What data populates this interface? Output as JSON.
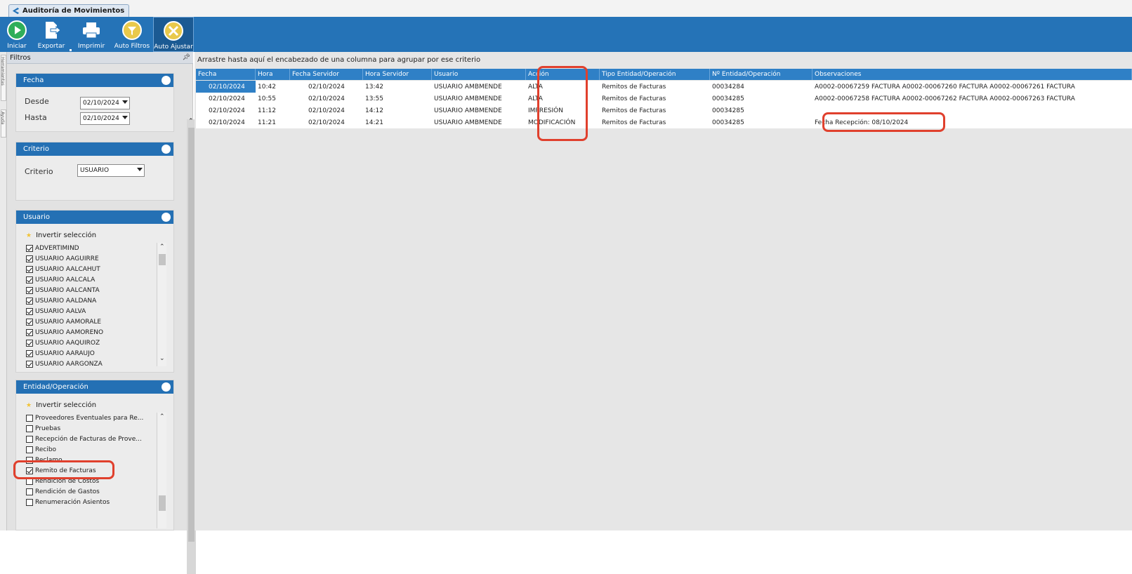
{
  "window": {
    "tab_title": "Auditoría de Movimientos"
  },
  "ribbon": {
    "buttons": [
      {
        "label": "Iniciar",
        "icon": "play-icon"
      },
      {
        "label": "Exportar",
        "icon": "export-icon"
      },
      {
        "label": "Imprimir",
        "icon": "printer-icon"
      },
      {
        "label": "Auto Filtros",
        "icon": "auto-filter-icon"
      },
      {
        "label": "Auto Ajustar",
        "icon": "auto-fit-icon"
      }
    ]
  },
  "side_tabs": [
    "Herramientas",
    "Ayuda"
  ],
  "filters": {
    "panel_title": "Filtros",
    "fecha": {
      "title": "Fecha",
      "desde_label": "Desde",
      "desde_value": "02/10/2024",
      "hasta_label": "Hasta",
      "hasta_value": "02/10/2024"
    },
    "criterio": {
      "title": "Criterio",
      "label": "Criterio",
      "value": "USUARIO"
    },
    "usuario": {
      "title": "Usuario",
      "invert_label": "Invertir selección",
      "items": [
        {
          "label": "ADVERTIMIND",
          "checked": true
        },
        {
          "label": "USUARIO AAGUIRRE",
          "checked": true
        },
        {
          "label": "USUARIO AALCAHUT",
          "checked": true
        },
        {
          "label": "USUARIO AALCALA",
          "checked": true
        },
        {
          "label": "USUARIO AALCANTA",
          "checked": true
        },
        {
          "label": "USUARIO AALDANA",
          "checked": true
        },
        {
          "label": "USUARIO AALVA",
          "checked": true
        },
        {
          "label": "USUARIO AAMORALE",
          "checked": true
        },
        {
          "label": "USUARIO AAMORENO",
          "checked": true
        },
        {
          "label": "USUARIO AAQUIROZ",
          "checked": true
        },
        {
          "label": "USUARIO AARAUJO",
          "checked": true
        },
        {
          "label": "USUARIO AARGONZA",
          "checked": true
        }
      ]
    },
    "entidad": {
      "title": "Entidad/Operación",
      "invert_label": "Invertir selección",
      "items": [
        {
          "label": "Proveedores Eventuales para Re...",
          "checked": false
        },
        {
          "label": "Pruebas",
          "checked": false
        },
        {
          "label": "Recepción de Facturas de Prove...",
          "checked": false
        },
        {
          "label": "Recibo",
          "checked": false
        },
        {
          "label": "Reclamo",
          "checked": false
        },
        {
          "label": "Remito de Facturas",
          "checked": true
        },
        {
          "label": "Rendición de Costos",
          "checked": false
        },
        {
          "label": "Rendición de Gastos",
          "checked": false
        },
        {
          "label": "Renumeración Asientos",
          "checked": false
        }
      ]
    }
  },
  "grid": {
    "group_hint": "Arrastre hasta aquí el encabezado de una columna para agrupar por ese criterio",
    "columns": [
      "Fecha",
      "Hora",
      "Fecha Servidor",
      "Hora Servidor",
      "Usuario",
      "Acción",
      "Tipo Entidad/Operación",
      "Nº Entidad/Operación",
      "Observaciones"
    ],
    "rows": [
      [
        "02/10/2024",
        "10:42",
        "02/10/2024",
        "13:42",
        "USUARIO AMBMENDE",
        "ALTA",
        "Remitos de Facturas",
        "00034284",
        "A0002-00067259 FACTURA  A0002-00067260 FACTURA  A0002-00067261 FACTURA"
      ],
      [
        "02/10/2024",
        "10:55",
        "02/10/2024",
        "13:55",
        "USUARIO AMBMENDE",
        "ALTA",
        "Remitos de Facturas",
        "00034285",
        "A0002-00067258 FACTURA  A0002-00067262 FACTURA  A0002-00067263 FACTURA"
      ],
      [
        "02/10/2024",
        "11:12",
        "02/10/2024",
        "14:12",
        "USUARIO AMBMENDE",
        "IMPRESIÓN",
        "Remitos de Facturas",
        "00034285",
        ""
      ],
      [
        "02/10/2024",
        "11:21",
        "02/10/2024",
        "14:21",
        "USUARIO AMBMENDE",
        "MODIFICACIÓN",
        "Remitos de Facturas",
        "00034285",
        "Fecha Recepción: 08/10/2024"
      ]
    ]
  },
  "colors": {
    "ribbon": "#2573b7",
    "group_header": "#2470b4",
    "grid_header": "#2f80c6",
    "highlight": "#e0402d"
  }
}
